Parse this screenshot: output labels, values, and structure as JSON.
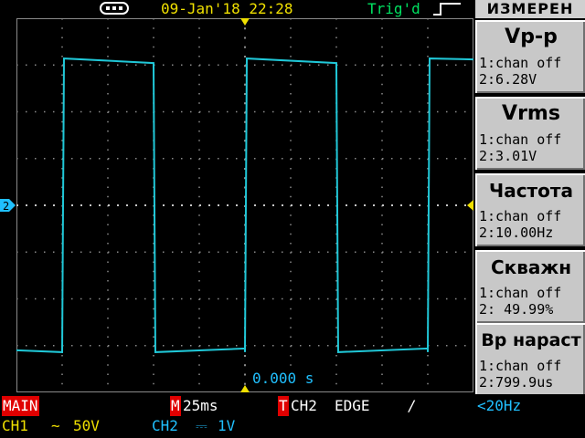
{
  "top": {
    "usb_icon": "usb-icon",
    "datetime": "09-Jan'18 22:28",
    "trig_status": "Trig'd",
    "trig_icon": "rising-edge-icon"
  },
  "menu": {
    "header": "ИЗМЕРЕН",
    "items": [
      {
        "title": "Vp-p",
        "line1": "1:chan off",
        "line2": "2:6.28V"
      },
      {
        "title": "Vrms",
        "line1": "1:chan off",
        "line2": "2:3.01V"
      },
      {
        "title": "Частота",
        "line1": "1:chan off",
        "line2": "2:10.00Hz"
      },
      {
        "title": "Скважн",
        "line1": "1:chan off",
        "line2": "2: 49.99%"
      },
      {
        "title": "Вр нараст",
        "line1": "1:chan off",
        "line2": "2:799.9us"
      }
    ]
  },
  "screen": {
    "ch2_marker": "2",
    "time_offset": "0.000 s",
    "trace_color": "#20c8d8",
    "grid_color": "#8a8a8a",
    "marker_color": "#f0e000",
    "waveform": {
      "type": "square",
      "frequency_hz": 10.0,
      "duty_percent": 49.99
    }
  },
  "status": {
    "main_label": "MAIN",
    "m_label": "M",
    "timebase": "25ms",
    "trig_t_label": "T",
    "trig_source": "CH2",
    "trig_type": "EDGE",
    "trig_slope": "/",
    "trig_freq": "<20Hz",
    "ch1_label": "CH1",
    "ch1_coupling": "∼",
    "ch1_scale": "50V",
    "ch2_label": "CH2",
    "ch2_coupling": "⎓",
    "ch2_scale": "1V"
  }
}
